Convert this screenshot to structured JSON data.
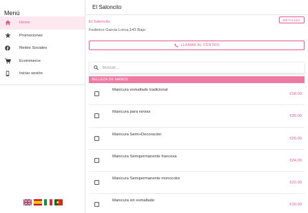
{
  "sidebar": {
    "title": "Menú",
    "items": [
      {
        "label": "Home",
        "icon": "home-icon",
        "active": true
      },
      {
        "label": "Promociones",
        "icon": "star-icon",
        "active": false
      },
      {
        "label": "Redes Sociales",
        "icon": "facebook-icon",
        "active": false
      },
      {
        "label": "Ecommerce",
        "icon": "cart-icon",
        "active": false
      },
      {
        "label": "Iniciar sesión",
        "icon": "phone-device-icon",
        "active": false
      }
    ],
    "flags": [
      "flag-uk-icon",
      "flag-spain-icon",
      "flag-italy-icon",
      "flag-portugal-icon"
    ]
  },
  "header": {
    "title": "El Saloncito"
  },
  "shop": {
    "name": "El Saloncito",
    "address": "Federico Garcia Lorca,143 Bajo",
    "details_label": "DETALLES",
    "call_label": "LLAMAR AL CENTRO"
  },
  "search": {
    "placeholder": "Buscar...",
    "value": ""
  },
  "category": {
    "label": "BELLEZA DE MANOS"
  },
  "services": [
    {
      "name": "Manicura esmaltado tradicional",
      "price": "€18.00"
    },
    {
      "name": "Manicura para novias",
      "price": "€35.00"
    },
    {
      "name": "Manicura Semi+Decoración",
      "price": "€25.00"
    },
    {
      "name": "Manicura Semipermanente francesa",
      "price": "€24.00"
    },
    {
      "name": "Manicura Semipermanente monocolor",
      "price": "€22.00"
    },
    {
      "name": "Manicura sin esmaltado",
      "price": "€10.00"
    }
  ],
  "colors": {
    "accent": "#e8578a",
    "category_bg": "#ee7aa2",
    "active_bg": "#fde8ef"
  }
}
